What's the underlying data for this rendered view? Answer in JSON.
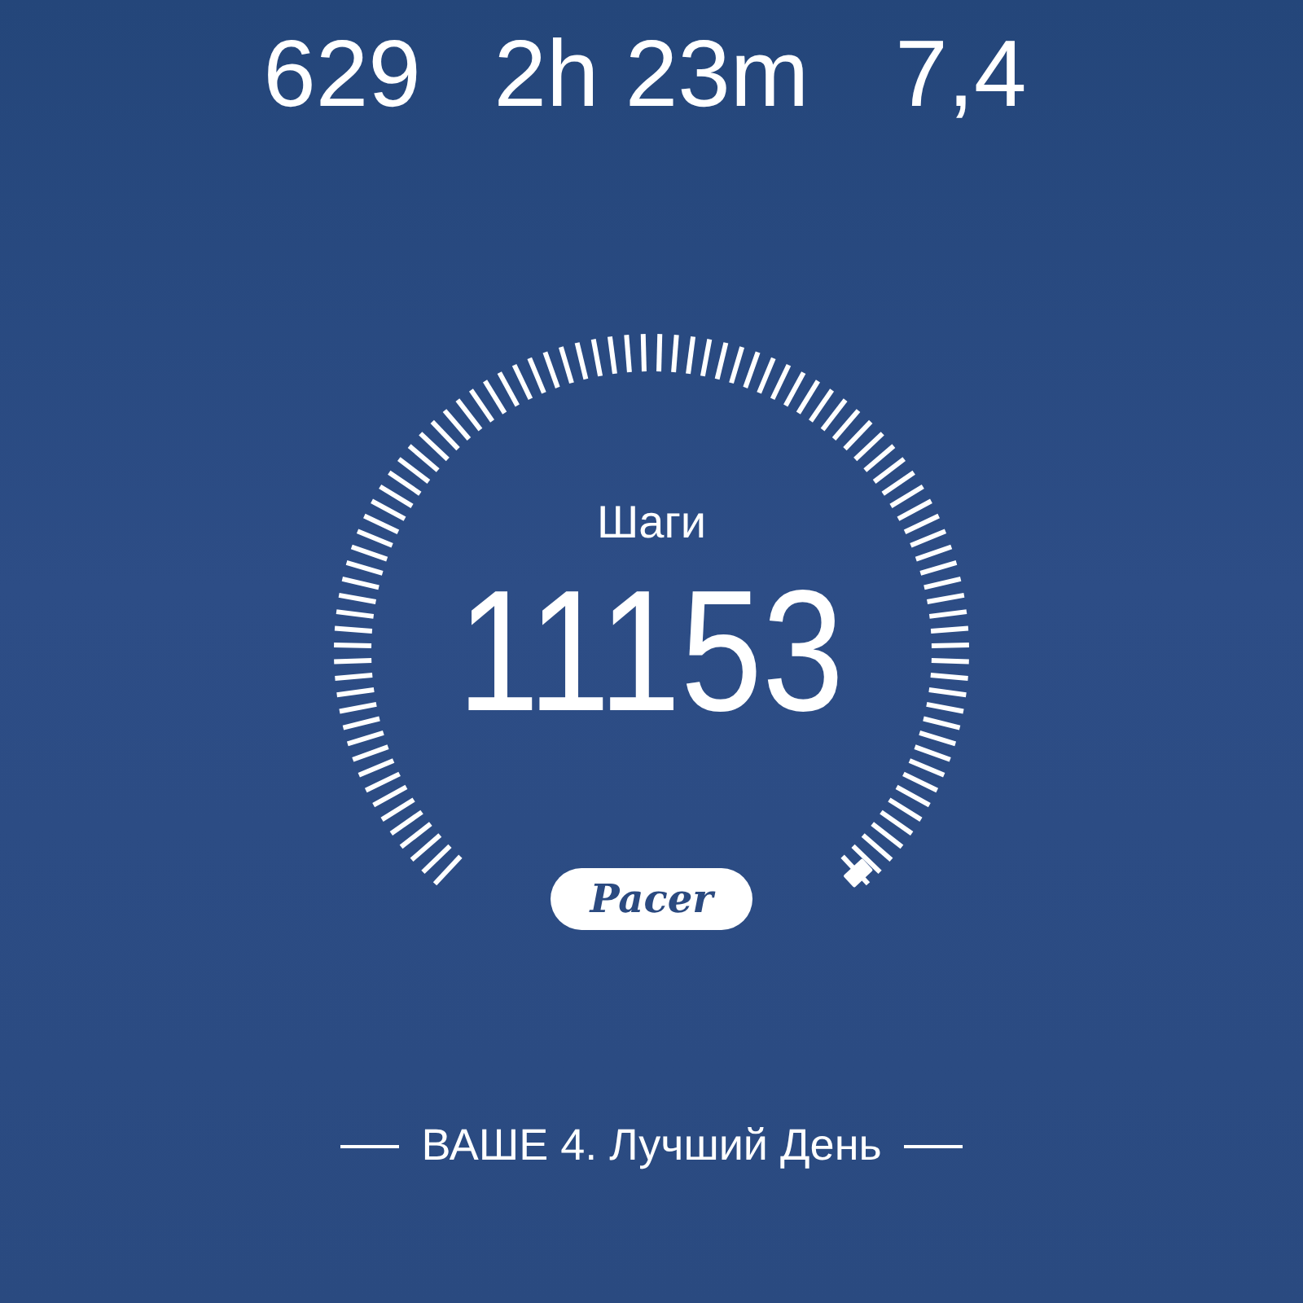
{
  "stats": [
    {
      "value": "629"
    },
    {
      "value": "2h 23m"
    },
    {
      "value": "7,4"
    }
  ],
  "gauge": {
    "label": "Шаги",
    "value": "11153"
  },
  "logo": "Pacer",
  "footer": "ВАШЕ 4. Лучший День"
}
